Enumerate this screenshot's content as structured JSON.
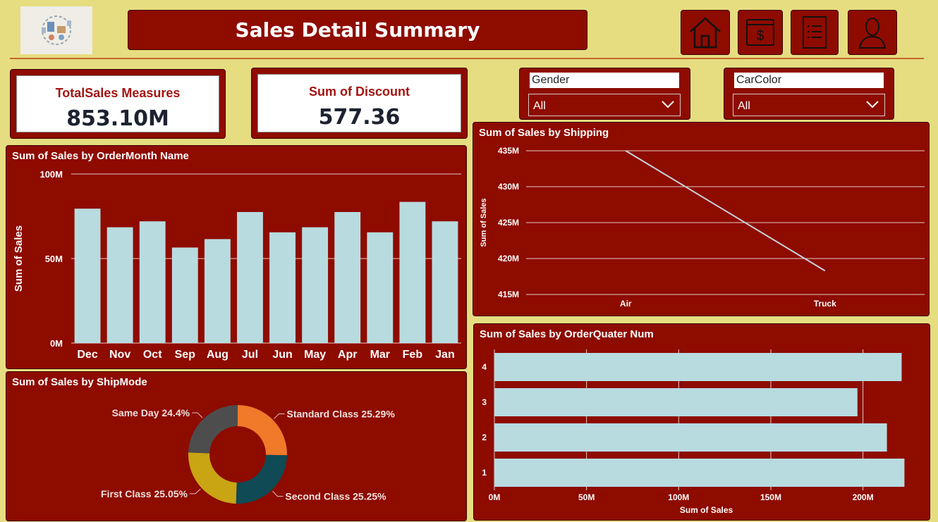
{
  "header": {
    "title": "Sales Detail Summary",
    "nav_icons": [
      "home-icon",
      "dollar-document-icon",
      "list-document-icon",
      "user-icon"
    ]
  },
  "cards": [
    {
      "label": "TotalSales Measures",
      "value": "853.10M"
    },
    {
      "label": "Sum of Discount",
      "value": "577.36"
    }
  ],
  "slicers": [
    {
      "label": "Gender",
      "value": "All"
    },
    {
      "label": "CarColor",
      "value": "All"
    }
  ],
  "colors": {
    "background": "#e6dd80",
    "panel": "#8e0b00",
    "bar": "#b8dbe0",
    "donut": [
      "#f07a2a",
      "#0f4a55",
      "#c9a514",
      "#4d4d4d"
    ]
  },
  "chart_data": [
    {
      "type": "bar",
      "title": "Sum of Sales by OrderMonth Name",
      "xlabel": "",
      "ylabel": "Sum of Sales",
      "categories": [
        "Dec",
        "Nov",
        "Oct",
        "Sep",
        "Aug",
        "Jul",
        "Jun",
        "May",
        "Apr",
        "Mar",
        "Feb",
        "Jan"
      ],
      "values": [
        79.5,
        68.5,
        72,
        56.5,
        61.5,
        77.5,
        65.5,
        68.5,
        77.5,
        65.5,
        83.5,
        72
      ],
      "unit": "M",
      "ylim": [
        0,
        100
      ],
      "yticks": [
        "0M",
        "50M",
        "100M"
      ],
      "grid": true
    },
    {
      "type": "line",
      "title": "Sum of Sales by Shipping",
      "xlabel": "",
      "ylabel": "Sum of Sales",
      "categories": [
        "Air",
        "Truck"
      ],
      "values": [
        435,
        418.3
      ],
      "unit": "M",
      "ylim": [
        415,
        435
      ],
      "yticks": [
        "415M",
        "420M",
        "425M",
        "430M",
        "435M"
      ],
      "grid": true
    },
    {
      "type": "pie",
      "title": "Sum of Sales by ShipMode",
      "slices": [
        {
          "label": "Standard Class 25.29%",
          "value": 25.29
        },
        {
          "label": "Second Class 25.25%",
          "value": 25.25
        },
        {
          "label": "First Class 25.05%",
          "value": 25.05
        },
        {
          "label": "Same Day 24.4%",
          "value": 24.4
        }
      ]
    },
    {
      "type": "bar",
      "orientation": "horizontal",
      "title": "Sum of Sales by OrderQuater Num",
      "xlabel": "Sum of Sales",
      "ylabel": "",
      "categories": [
        "4",
        "3",
        "2",
        "1"
      ],
      "values": [
        221,
        197,
        213,
        222.5
      ],
      "unit": "M",
      "xlim": [
        0,
        230
      ],
      "xticks": [
        "0M",
        "50M",
        "100M",
        "150M",
        "200M"
      ],
      "grid": true
    }
  ]
}
